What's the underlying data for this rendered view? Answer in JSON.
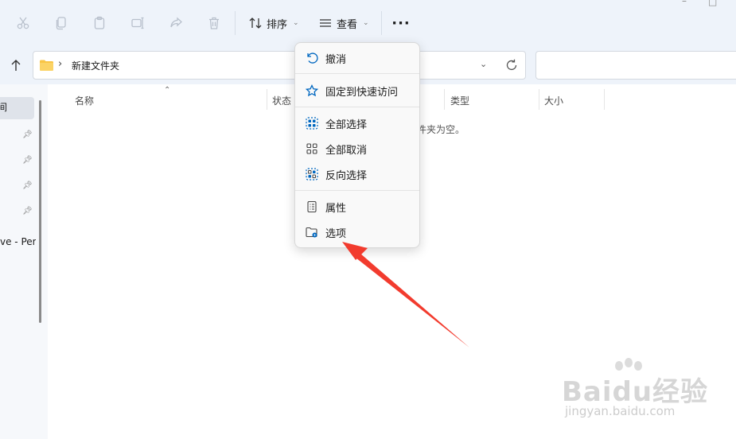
{
  "toolbar": {
    "sort_label": "排序",
    "view_label": "查看",
    "more_label": "···",
    "window_min": "–",
    "window_max": "□"
  },
  "address": {
    "path": "新建文件夹",
    "separator": "›"
  },
  "nav": {
    "selected_label": "间",
    "onedrive_label": "ve - Pers"
  },
  "columns": {
    "name": "名称",
    "status": "状态",
    "type": "类型",
    "size": "大小"
  },
  "content": {
    "empty_message": "件夹为空。"
  },
  "menu": {
    "items": [
      {
        "label": "撤消",
        "icon": "undo-icon"
      },
      {
        "label": "固定到快速访问",
        "icon": "star-icon"
      },
      {
        "label": "全部选择",
        "icon": "select-all-icon"
      },
      {
        "label": "全部取消",
        "icon": "select-none-icon"
      },
      {
        "label": "反向选择",
        "icon": "invert-selection-icon"
      },
      {
        "label": "属性",
        "icon": "properties-icon"
      },
      {
        "label": "选项",
        "icon": "folder-options-icon"
      }
    ]
  },
  "watermark": {
    "brand": "Baidu经验",
    "url": "jingyan.baidu.com"
  },
  "colors": {
    "accent": "#0067c0",
    "annotation_arrow": "#f23b2e",
    "toolbar_bg": "#eef3fa",
    "folder": "#f8c545"
  }
}
